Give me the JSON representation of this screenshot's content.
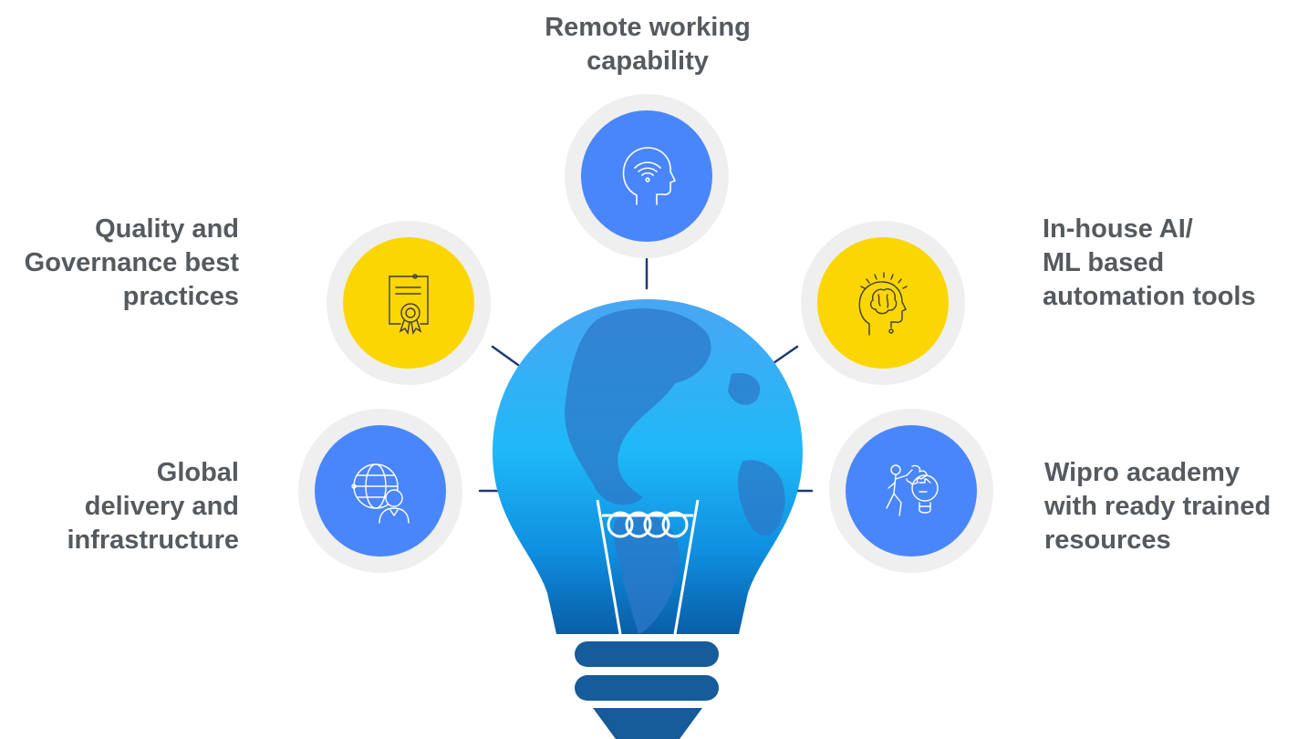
{
  "colors": {
    "blue_disc": "#4a86fb",
    "yellow_disc": "#fcd600",
    "ring": "#efefef",
    "connector": "#1e3a72",
    "label_text": "#555a5f",
    "bulb_top": "#4aa6f5",
    "bulb_bottom": "#0a5da7",
    "bulb_base": "#165b9a"
  },
  "center": {
    "icon": "globe-lightbulb-icon"
  },
  "items": [
    {
      "id": "remote",
      "icon": "wifi-head-icon",
      "color": "blue",
      "lines": [
        "Remote working",
        "capability"
      ]
    },
    {
      "id": "quality",
      "icon": "certificate-icon",
      "color": "yellow",
      "lines": [
        "Quality and",
        "Governance best",
        "practices"
      ]
    },
    {
      "id": "ai_ml",
      "icon": "brain-head-icon",
      "color": "yellow",
      "lines": [
        "In-house AI/",
        "ML based",
        "automation tools"
      ]
    },
    {
      "id": "global",
      "icon": "globe-user-icon",
      "color": "blue",
      "lines": [
        "Global",
        "delivery and",
        "infrastructure"
      ]
    },
    {
      "id": "academy",
      "icon": "puzzle-person-icon",
      "color": "blue",
      "lines": [
        "Wipro academy",
        "with ready trained",
        "resources"
      ]
    }
  ]
}
